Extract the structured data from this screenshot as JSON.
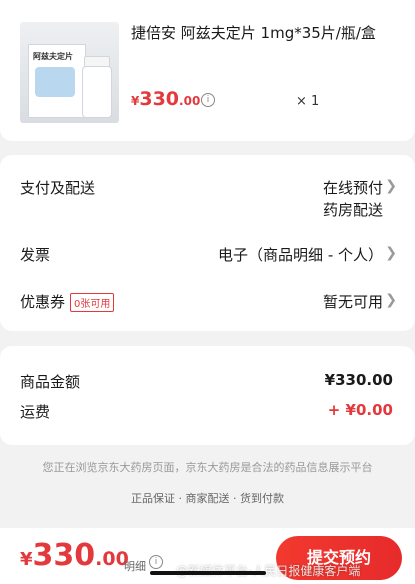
{
  "product": {
    "name": "捷倍安 阿兹夫定片 1mg*35片/瓶/盒",
    "box_label": "阿兹夫定片",
    "price_symbol": "¥",
    "price_int": "330",
    "price_dec": ".00",
    "quantity": "× 1"
  },
  "delivery": {
    "payment_label": "支付及配送",
    "payment_value_line1": "在线预付",
    "payment_value_line2": "药房配送",
    "invoice_label": "发票",
    "invoice_value": "电子（商品明细 - 个人）",
    "coupon_label": "优惠券",
    "coupon_badge": "0张可用",
    "coupon_value": "暂无可用"
  },
  "amounts": {
    "goods_label": "商品金额",
    "goods_value": "¥330.00",
    "freight_label": "运费",
    "freight_value": "+ ¥0.00"
  },
  "notice": "您正在浏览京东大药房页面，京东大药房是合法的药品信息展示平台",
  "guarantee": "正品保证 · 商家配送 · 货到付款",
  "bottom": {
    "total_symbol": "¥",
    "total_int": "330",
    "total_dec": ".00",
    "detail_label": "明细",
    "submit_label": "提交预约",
    "watermark": "@新媒体平台-人民日报健康客户端"
  },
  "colors": {
    "accent": "#e4393c",
    "background": "#f2f2f2"
  }
}
